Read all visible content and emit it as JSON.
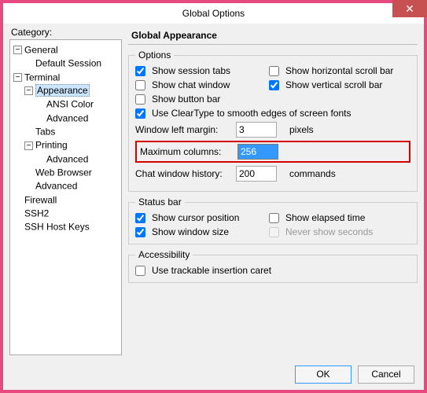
{
  "titlebar": {
    "title": "Global Options"
  },
  "category_label": "Category:",
  "tree": {
    "general": "General",
    "default_session": "Default Session",
    "terminal": "Terminal",
    "appearance": "Appearance",
    "ansi_color": "ANSI Color",
    "appearance_advanced": "Advanced",
    "tabs": "Tabs",
    "printing": "Printing",
    "printing_advanced": "Advanced",
    "web_browser": "Web Browser",
    "terminal_advanced": "Advanced",
    "firewall": "Firewall",
    "ssh2": "SSH2",
    "ssh_host_keys": "SSH Host Keys"
  },
  "panel_title": "Global Appearance",
  "options": {
    "legend": "Options",
    "show_session_tabs": "Show session tabs",
    "show_horizontal_scroll": "Show horizontal scroll bar",
    "show_chat_window": "Show chat window",
    "show_vertical_scroll": "Show vertical scroll bar",
    "show_button_bar": "Show button bar",
    "use_cleartype": "Use ClearType to smooth edges of screen fonts",
    "window_left_margin_label": "Window left margin:",
    "window_left_margin_value": "3",
    "window_left_margin_unit": "pixels",
    "maximum_columns_label": "Maximum columns:",
    "maximum_columns_value": "256",
    "chat_history_label": "Chat window history:",
    "chat_history_value": "200",
    "chat_history_unit": "commands",
    "checked": {
      "show_session_tabs": true,
      "show_horizontal_scroll": false,
      "show_chat_window": false,
      "show_vertical_scroll": true,
      "show_button_bar": false,
      "use_cleartype": true
    }
  },
  "statusbar": {
    "legend": "Status bar",
    "show_cursor_position": "Show cursor position",
    "show_elapsed_time": "Show elapsed time",
    "show_window_size": "Show window size",
    "never_show_seconds": "Never show seconds",
    "checked": {
      "show_cursor_position": true,
      "show_elapsed_time": false,
      "show_window_size": true,
      "never_show_seconds": false
    }
  },
  "accessibility": {
    "legend": "Accessibility",
    "use_trackable_caret": "Use trackable insertion caret",
    "checked": {
      "use_trackable_caret": false
    }
  },
  "buttons": {
    "ok": "OK",
    "cancel": "Cancel"
  }
}
